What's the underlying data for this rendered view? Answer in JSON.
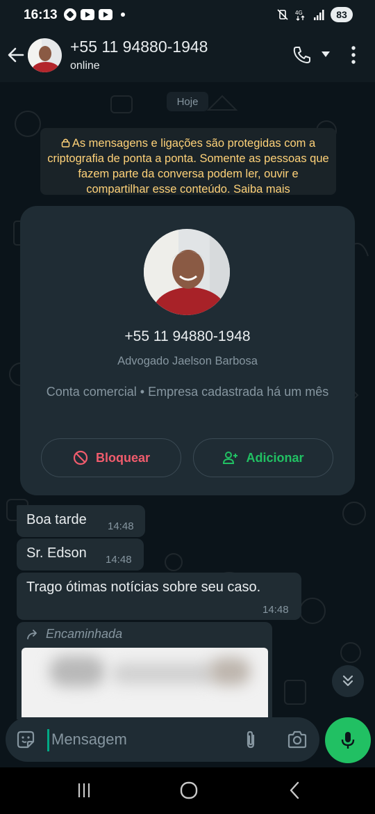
{
  "status_bar": {
    "time": "16:13",
    "battery": "83",
    "network": "4G"
  },
  "header": {
    "contact_name": "+55 11 94880-1948",
    "status": "online"
  },
  "chat": {
    "date_chip": "Hoje",
    "encryption_note": "As mensagens e ligações são protegidas com a criptografia de ponta a ponta. Somente as pessoas que fazem parte da conversa podem ler, ouvir e compartilhar esse conteúdo. Saiba mais",
    "business_card": {
      "phone": "+55 11 94880-1948",
      "name": "Advogado Jaelson Barbosa",
      "business_info": "Conta comercial • Empresa cadastrada há um mês",
      "block_label": "Bloquear",
      "add_label": "Adicionar"
    },
    "messages": [
      {
        "text": "Boa tarde",
        "time": "14:48"
      },
      {
        "text": "Sr. Edson",
        "time": "14:48"
      },
      {
        "text": "Trago ótimas notícias sobre seu caso.",
        "time": "14:48"
      }
    ],
    "forwarded_label": "Encaminhada"
  },
  "composer": {
    "placeholder": "Mensagem"
  },
  "colors": {
    "background": "#0b141a",
    "header": "#111b21",
    "bubble": "#202c33",
    "accent_green": "#21c063",
    "encryption_text": "#ffd279",
    "block_red": "#f15c6d"
  },
  "icons": [
    "back-arrow-icon",
    "call-icon",
    "dropdown-icon",
    "more-icon",
    "lock-icon",
    "block-icon",
    "add-contact-icon",
    "forward-icon",
    "scroll-down-icon",
    "sticker-icon",
    "attach-icon",
    "camera-icon",
    "mic-icon"
  ]
}
